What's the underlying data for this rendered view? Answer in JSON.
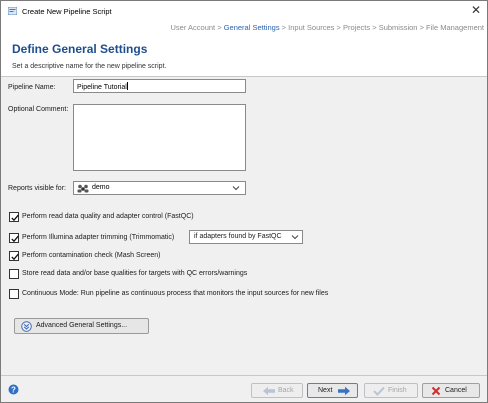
{
  "window": {
    "title": "Create New Pipeline Script",
    "close_icon": "close-icon"
  },
  "breadcrumb": {
    "items": [
      "User Account",
      "General Settings",
      "Input Sources",
      "Projects",
      "Submission",
      "File Management"
    ],
    "separator": ">",
    "current_index": 1
  },
  "header": {
    "title": "Define General Settings",
    "subtitle": "Set a descriptive name for the new pipeline script."
  },
  "form": {
    "pipeline_name_label": "Pipeline Name:",
    "pipeline_name_value": "Pipeline Tutorial",
    "optional_comment_label": "Optional Comment:",
    "optional_comment_value": "",
    "reports_visible_label": "Reports visible for:",
    "reports_visible_value": "demo"
  },
  "options": [
    {
      "label": "Perform read data quality and adapter control (FastQC)",
      "checked": true
    },
    {
      "label": "Perform Illumina adapter trimming (Trimmomatic)",
      "checked": true
    },
    {
      "label": "Perform contamination check (Mash Screen)",
      "checked": true
    },
    {
      "label": "Store read data and/or base qualities for targets with QC errors/warnings",
      "checked": false
    },
    {
      "label": "Continuous Mode: Run pipeline as continuous process that monitors the input sources for new files",
      "checked": false
    }
  ],
  "trimming_mode": {
    "selected": "if adapters found by FastQC"
  },
  "advanced_button": {
    "label": "Advanced General Settings..."
  },
  "footer": {
    "back_label": "Back",
    "next_label": "Next",
    "finish_label": "Finish",
    "cancel_label": "Cancel"
  },
  "colors": {
    "title_blue": "#1f4e8c",
    "breadcrumb_current": "#2a64b0",
    "breadcrumb_inactive": "#8a8a8a",
    "cancel_red": "#d03030"
  }
}
